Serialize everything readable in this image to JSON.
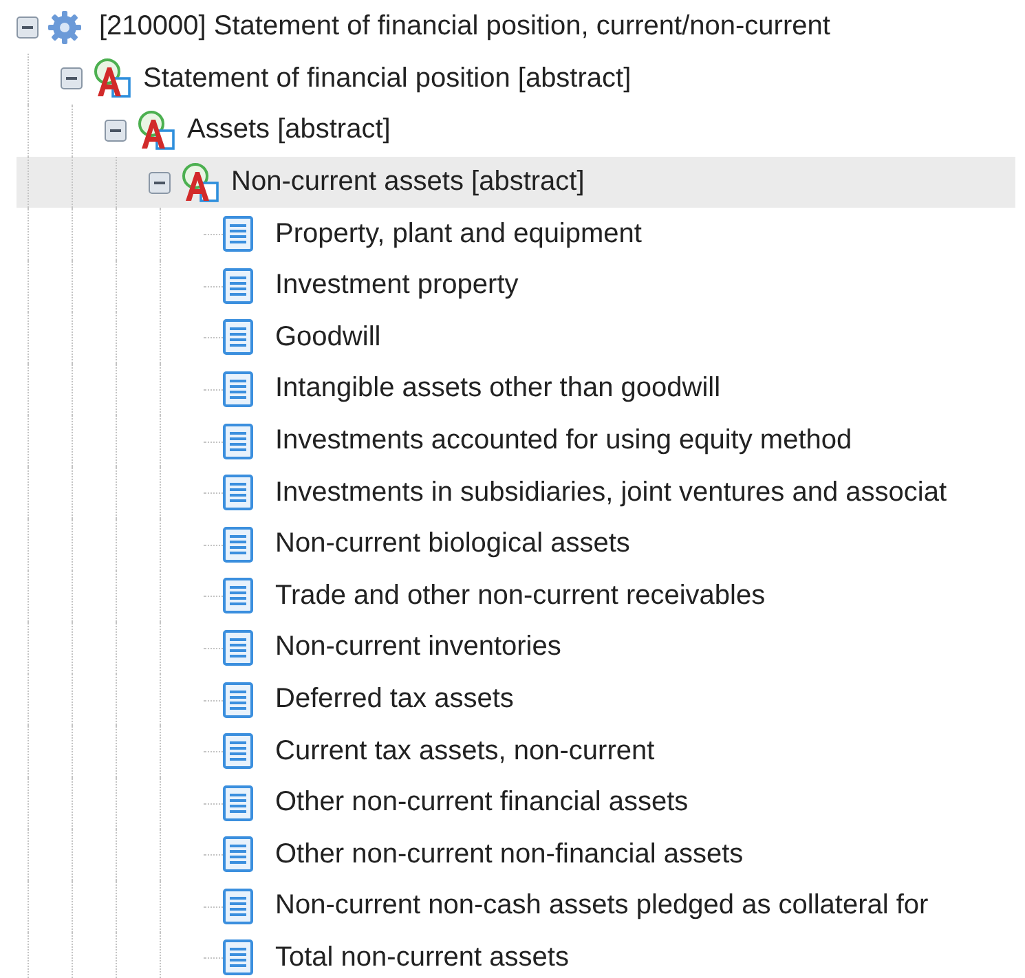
{
  "tree": {
    "label": "[210000] Statement of financial position, current/non-current",
    "kind": "group",
    "expanded": true,
    "selected": false,
    "children": [
      {
        "label": "Statement of financial position [abstract]",
        "kind": "abstract",
        "expanded": true,
        "selected": false,
        "children": [
          {
            "label": "Assets [abstract]",
            "kind": "abstract",
            "expanded": true,
            "selected": false,
            "children": [
              {
                "label": "Non-current assets [abstract]",
                "kind": "abstract",
                "expanded": true,
                "selected": true,
                "children": [
                  {
                    "label": "Property, plant and equipment",
                    "kind": "concept",
                    "selected": false
                  },
                  {
                    "label": "Investment property",
                    "kind": "concept",
                    "selected": false
                  },
                  {
                    "label": "Goodwill",
                    "kind": "concept",
                    "selected": false
                  },
                  {
                    "label": "Intangible assets other than goodwill",
                    "kind": "concept",
                    "selected": false
                  },
                  {
                    "label": "Investments accounted for using equity method",
                    "kind": "concept",
                    "selected": false
                  },
                  {
                    "label": "Investments in subsidiaries, joint ventures and associat",
                    "kind": "concept",
                    "selected": false
                  },
                  {
                    "label": "Non-current biological assets",
                    "kind": "concept",
                    "selected": false
                  },
                  {
                    "label": "Trade and other non-current receivables",
                    "kind": "concept",
                    "selected": false
                  },
                  {
                    "label": "Non-current inventories",
                    "kind": "concept",
                    "selected": false
                  },
                  {
                    "label": "Deferred tax assets",
                    "kind": "concept",
                    "selected": false
                  },
                  {
                    "label": "Current tax assets, non-current",
                    "kind": "concept",
                    "selected": false
                  },
                  {
                    "label": "Other non-current financial assets",
                    "kind": "concept",
                    "selected": false
                  },
                  {
                    "label": "Other non-current non-financial assets",
                    "kind": "concept",
                    "selected": false
                  },
                  {
                    "label": "Non-current non-cash assets pledged as collateral for",
                    "kind": "concept",
                    "selected": false
                  },
                  {
                    "label": "Total non-current assets",
                    "kind": "concept",
                    "selected": false
                  }
                ]
              }
            ]
          }
        ]
      }
    ]
  }
}
